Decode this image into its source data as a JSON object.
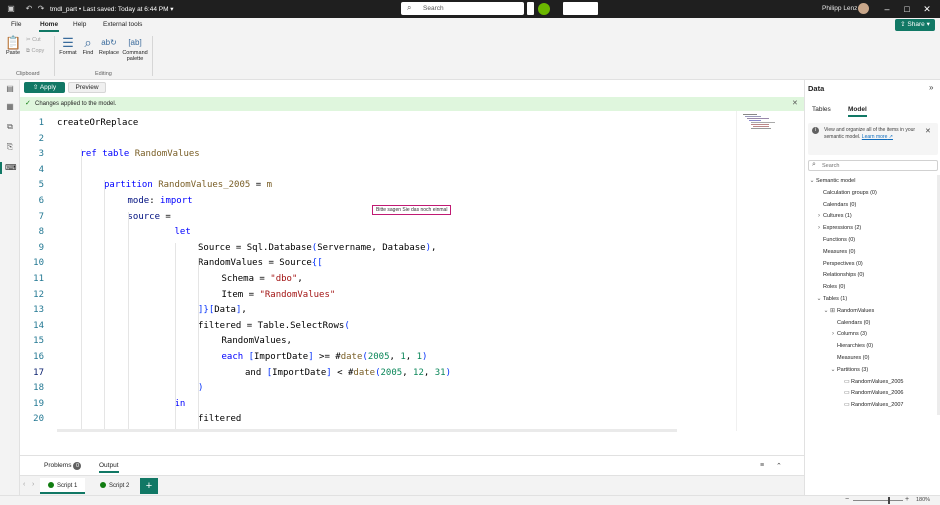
{
  "titlebar": {
    "doc_title": "tmdl_part • Last saved: Today at 6:44 PM",
    "search_placeholder": "Search",
    "user_name": "Philipp Lenz"
  },
  "menu": {
    "items": [
      "File",
      "Home",
      "Help",
      "External tools"
    ],
    "share_label": "Share"
  },
  "ribbon": {
    "paste": "Paste",
    "cut": "Cut",
    "copy": "Copy",
    "format": "Format",
    "find": "Find",
    "replace": "Replace",
    "command_palette_line1": "Command",
    "command_palette_line2": "palette",
    "group_clipboard": "Clipboard",
    "group_editing": "Editing"
  },
  "editor": {
    "apply_label": "Apply",
    "preview_label": "Preview",
    "banner_text": "Changes applied to the model.",
    "tooltip": "Bitte sagen Sie das noch einmal",
    "current_line": 17
  },
  "bottom": {
    "problems_label": "Problems",
    "problems_count": "0",
    "output_label": "Output",
    "scripts": [
      "Script 1",
      "Script 2"
    ]
  },
  "status": {
    "zoom": "180%"
  },
  "data_pane": {
    "title": "Data",
    "tabs": [
      "Tables",
      "Model"
    ],
    "info_text": "View and organize all of the items in your semantic model.",
    "info_link": "Learn more",
    "search_placeholder": "Search",
    "tree": [
      {
        "label": "Semantic model",
        "depth": 0,
        "twisty": "expanded",
        "icon": ""
      },
      {
        "label": "Calculation groups (0)",
        "depth": 1,
        "twisty": "",
        "icon": ""
      },
      {
        "label": "Calendars (0)",
        "depth": 1,
        "twisty": "",
        "icon": ""
      },
      {
        "label": "Cultures (1)",
        "depth": 1,
        "twisty": "collapsed",
        "icon": ""
      },
      {
        "label": "Expressions (2)",
        "depth": 1,
        "twisty": "collapsed",
        "icon": ""
      },
      {
        "label": "Functions (0)",
        "depth": 1,
        "twisty": "",
        "icon": ""
      },
      {
        "label": "Measures (0)",
        "depth": 1,
        "twisty": "",
        "icon": ""
      },
      {
        "label": "Perspectives (0)",
        "depth": 1,
        "twisty": "",
        "icon": ""
      },
      {
        "label": "Relationships (0)",
        "depth": 1,
        "twisty": "",
        "icon": ""
      },
      {
        "label": "Roles (0)",
        "depth": 1,
        "twisty": "",
        "icon": ""
      },
      {
        "label": "Tables (1)",
        "depth": 1,
        "twisty": "expanded",
        "icon": ""
      },
      {
        "label": "RandomValues",
        "depth": 2,
        "twisty": "expanded",
        "icon": "table"
      },
      {
        "label": "Calendars (0)",
        "depth": 3,
        "twisty": "",
        "icon": ""
      },
      {
        "label": "Columns (3)",
        "depth": 3,
        "twisty": "collapsed",
        "icon": ""
      },
      {
        "label": "Hierarchies (0)",
        "depth": 3,
        "twisty": "",
        "icon": ""
      },
      {
        "label": "Measures (0)",
        "depth": 3,
        "twisty": "",
        "icon": ""
      },
      {
        "label": "Partitions (3)",
        "depth": 3,
        "twisty": "expanded",
        "icon": ""
      },
      {
        "label": "RandomValues_2005",
        "depth": 4,
        "twisty": "",
        "icon": "partition"
      },
      {
        "label": "RandomValues_2006",
        "depth": 4,
        "twisty": "",
        "icon": "partition"
      },
      {
        "label": "RandomValues_2007",
        "depth": 4,
        "twisty": "",
        "icon": "partition"
      }
    ]
  },
  "code_lines": [
    {
      "n": "1",
      "indent": 0,
      "tokens": [
        [
          "createOrReplace",
          "cm"
        ]
      ]
    },
    {
      "n": "2",
      "indent": 0,
      "tokens": []
    },
    {
      "n": "3",
      "indent": 1,
      "tokens": [
        [
          "ref ",
          "kw"
        ],
        [
          "table ",
          "kw"
        ],
        [
          "RandomValues",
          "fn"
        ]
      ]
    },
    {
      "n": "4",
      "indent": 0,
      "tokens": []
    },
    {
      "n": "5",
      "indent": 2,
      "tokens": [
        [
          "partition ",
          "kw"
        ],
        [
          "RandomValues_2005",
          "fn"
        ],
        [
          " = ",
          "cm"
        ],
        [
          "m",
          "fn"
        ]
      ]
    },
    {
      "n": "6",
      "indent": 3,
      "tokens": [
        [
          "mode",
          "id"
        ],
        [
          ": ",
          "cm"
        ],
        [
          "import",
          "kw"
        ]
      ]
    },
    {
      "n": "7",
      "indent": 3,
      "tokens": [
        [
          "source",
          "id"
        ],
        [
          " =",
          "cm"
        ]
      ]
    },
    {
      "n": "8",
      "indent": 5,
      "tokens": [
        [
          "let",
          "kw"
        ]
      ]
    },
    {
      "n": "9",
      "indent": 6,
      "tokens": [
        [
          "Source = Sql.Database",
          "cm"
        ],
        [
          "(",
          "pu"
        ],
        [
          "Servername, Database",
          "cm"
        ],
        [
          ")",
          "pu"
        ],
        [
          ",",
          "cm"
        ]
      ]
    },
    {
      "n": "10",
      "indent": 6,
      "tokens": [
        [
          "RandomValues = Source",
          "cm"
        ],
        [
          "{[",
          "pu"
        ]
      ]
    },
    {
      "n": "11",
      "indent": 7,
      "tokens": [
        [
          "Schema = ",
          "cm"
        ],
        [
          "\"dbo\"",
          "str"
        ],
        [
          ",",
          "cm"
        ]
      ]
    },
    {
      "n": "12",
      "indent": 7,
      "tokens": [
        [
          "Item = ",
          "cm"
        ],
        [
          "\"RandomValues\"",
          "str"
        ]
      ]
    },
    {
      "n": "13",
      "indent": 6,
      "tokens": [
        [
          "]}[",
          "pu"
        ],
        [
          "Data",
          "cm"
        ],
        [
          "]",
          "pu"
        ],
        [
          ",",
          "cm"
        ]
      ]
    },
    {
      "n": "14",
      "indent": 6,
      "tokens": [
        [
          "filtered = Table.SelectRows",
          "cm"
        ],
        [
          "(",
          "pu"
        ]
      ]
    },
    {
      "n": "15",
      "indent": 7,
      "tokens": [
        [
          "RandomValues,",
          "cm"
        ]
      ]
    },
    {
      "n": "16",
      "indent": 7,
      "tokens": [
        [
          "each ",
          "kw"
        ],
        [
          "[",
          "pu"
        ],
        [
          "ImportDate",
          "cm"
        ],
        [
          "]",
          "pu"
        ],
        [
          " >= #",
          "cm"
        ],
        [
          "date",
          "fn"
        ],
        [
          "(",
          "pu"
        ],
        [
          "2005",
          "num"
        ],
        [
          ", ",
          "cm"
        ],
        [
          "1",
          "num"
        ],
        [
          ", ",
          "cm"
        ],
        [
          "1",
          "num"
        ],
        [
          ")",
          "pu"
        ]
      ]
    },
    {
      "n": "17",
      "indent": 8,
      "tokens": [
        [
          "and ",
          "cm"
        ],
        [
          "[",
          "pu"
        ],
        [
          "ImportDate",
          "cm"
        ],
        [
          "]",
          "pu"
        ],
        [
          " < #",
          "cm"
        ],
        [
          "date",
          "fn"
        ],
        [
          "(",
          "pu"
        ],
        [
          "2005",
          "num"
        ],
        [
          ", ",
          "cm"
        ],
        [
          "12",
          "num"
        ],
        [
          ", ",
          "cm"
        ],
        [
          "31",
          "num"
        ],
        [
          ")",
          "pu"
        ]
      ]
    },
    {
      "n": "18",
      "indent": 6,
      "tokens": [
        [
          ")",
          "pu"
        ]
      ]
    },
    {
      "n": "19",
      "indent": 5,
      "tokens": [
        [
          "in",
          "kw"
        ]
      ]
    },
    {
      "n": "20",
      "indent": 6,
      "tokens": [
        [
          "filtered",
          "cm"
        ]
      ]
    }
  ]
}
